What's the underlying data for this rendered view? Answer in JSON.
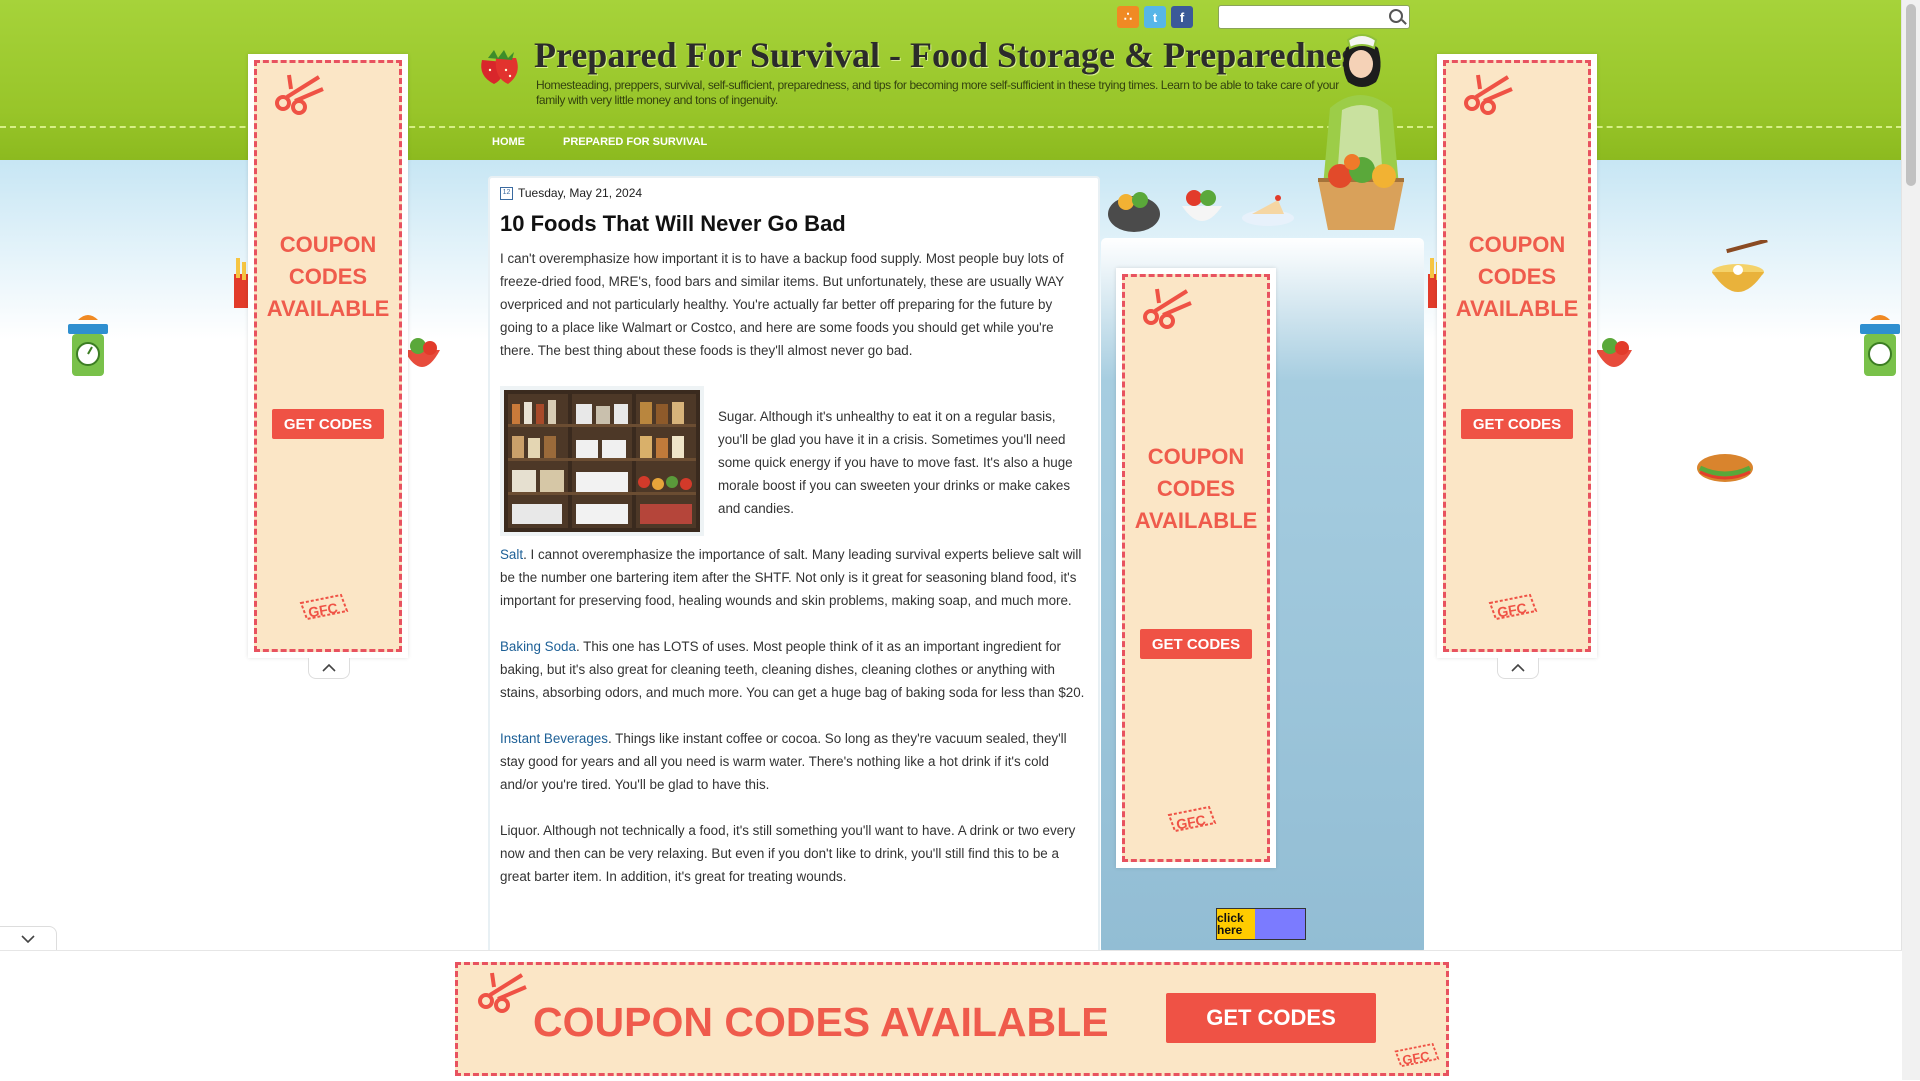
{
  "header": {
    "title": "Prepared For Survival - Food Storage & Preparedness",
    "description": "Homesteading, preppers, survival, self-sufficient, preparedness, and tips for becoming more self-sufficient in these trying times. Learn to be able to take care of your family with very little money and tons of ingenuity.",
    "social_icons": [
      "rss-icon",
      "twitter-icon",
      "facebook-icon"
    ],
    "search": {
      "placeholder": "",
      "value": ""
    }
  },
  "nav": {
    "items": [
      "HOME",
      "PREPARED FOR SURVIVAL"
    ]
  },
  "post": {
    "date": "Tuesday, May 21, 2024",
    "title": "10 Foods That Will Never Go Bad",
    "intro": "I can't overemphasize how important it is to have a backup food supply. Most people buy lots of freeze-dried food, MRE's, food bars and similar items. But unfortunately, these are usually WAY overpriced and not particularly healthy. You're actually far better off preparing for the future by going to a place like Walmart or Costco, and here are some foods you should get while you're there. The best thing about these foods is they'll almost never go bad.",
    "sugar": "Sugar. Although it's unhealthy to eat it on a regular basis, you'll be glad you have it in a crisis. Sometimes you'll need some quick energy if you have to move fast. It's also a huge morale boost if you can sweeten your drinks or make cakes and candies.",
    "salt_link": "Salt",
    "salt_text": ". I cannot overemphasize the importance of salt. Many leading survival experts believe salt will be the number one bartering item after the SHTF. Not only is it great for seasoning bland food, it's important for preserving food, healing wounds and skin problems, making soap, and much more.",
    "baking_link": "Baking Soda",
    "baking_text": ". This one has LOTS of uses. Most people think of it as an important ingredient for baking, but it's also great for cleaning teeth, cleaning dishes, cleaning clothes or anything with stains, absorbing odors, and much more. You can get a huge bag of baking soda for less than $20.",
    "beverages_link": "Instant Beverages",
    "beverages_text": ". Things like instant coffee or cocoa. So long as they're vacuum sealed, they'll stay good for years and all you need is warm water. There's nothing like a hot drink if it's cold and/or you're tired. You'll be glad to have this.",
    "liquor": "Liquor. Although not technically a food, it's still something you'll want to have. A drink or two every now and then can be very relaxing. But even if you don't like to drink, you'll still find this to be a great barter item. In addition, it's great for treating wounds."
  },
  "ads": {
    "coupon_line1": "COUPON",
    "coupon_line2": "CODES",
    "coupon_line3": "AVAILABLE",
    "get_codes": "GET CODES",
    "gfc": "GFC",
    "banner_text": "COUPON CODES AVAILABLE"
  },
  "sidebar": {
    "click_here": "click here"
  },
  "colors": {
    "header_green": "#98c529",
    "coupon_red": "#ef5245",
    "coupon_bg": "#fbe6c6",
    "link_blue": "#1c5f96",
    "sidebar_blue": "#92bdd4"
  }
}
